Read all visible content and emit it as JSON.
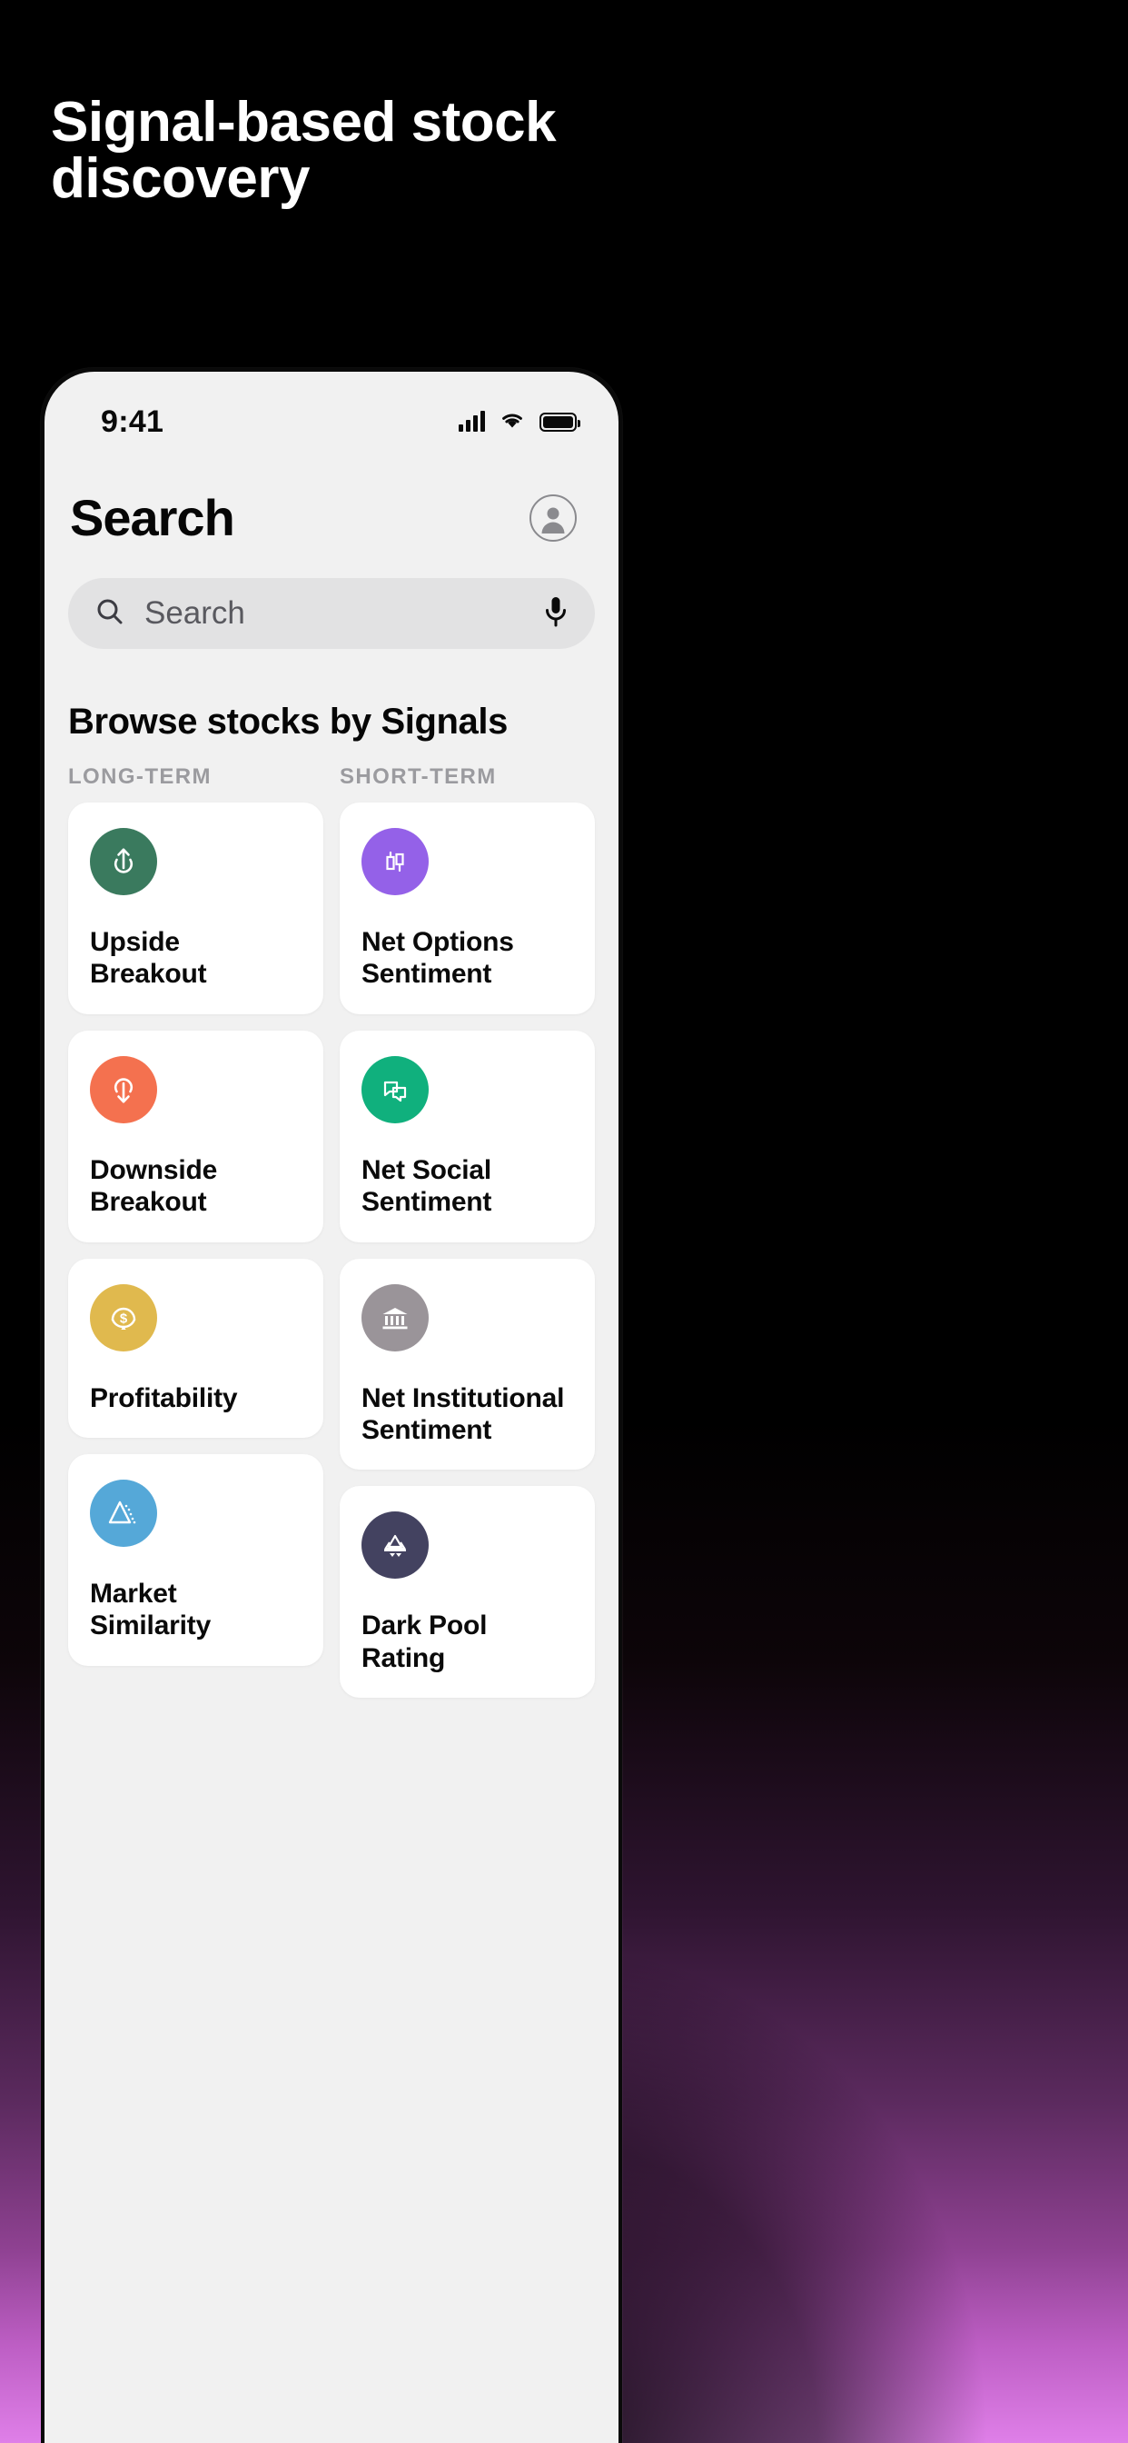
{
  "promo": {
    "headline": "Signal-based stock\ndiscovery"
  },
  "theme": {
    "backdrop_top": "#000000",
    "backdrop_bottom": "#df7fe8",
    "screen_bg": "#f1f1f1",
    "card_bg": "#ffffff",
    "searchbar_bg": "#e2e2e3"
  },
  "statusbar": {
    "time": "9:41",
    "cellular_icon": "cellular-bars-icon",
    "wifi_icon": "wifi-icon",
    "battery_icon": "battery-icon"
  },
  "header": {
    "title": "Search",
    "avatar_icon": "account-avatar-icon"
  },
  "search": {
    "placeholder": "Search",
    "value": "",
    "search_icon": "search-icon",
    "mic_icon": "microphone-icon"
  },
  "browse": {
    "section_title": "Browse stocks by Signals",
    "column_labels": [
      "LONG-TERM",
      "SHORT-TERM"
    ],
    "long_term": [
      {
        "label": "Upside Breakout",
        "icon": "arrow-up-breakout-icon",
        "color": "#3a7a5e",
        "lines": 1
      },
      {
        "label": "Downside Breakout",
        "icon": "arrow-down-breakout-icon",
        "color": "#f4714f",
        "lines": 1
      },
      {
        "label": "Profitability",
        "icon": "dollar-circle-icon",
        "color": "#e0b94e",
        "lines": 1
      },
      {
        "label": "Market Similarity",
        "icon": "triangle-scatter-icon",
        "color": "#55a8d8",
        "lines": 1
      }
    ],
    "short_term": [
      {
        "label": "Net Options Sentiment",
        "icon": "candlestick-icon",
        "color": "#9461e8",
        "lines": 2
      },
      {
        "label": "Net Social Sentiment",
        "icon": "chat-bubbles-icon",
        "color": "#10b07d",
        "lines": 1
      },
      {
        "label": "Net Institutional Sentiment",
        "icon": "bank-building-icon",
        "color": "#9a9499",
        "lines": 2
      },
      {
        "label": "Dark Pool Rating",
        "icon": "mountain-reflection-icon",
        "color": "#434260",
        "lines": 1
      }
    ]
  }
}
